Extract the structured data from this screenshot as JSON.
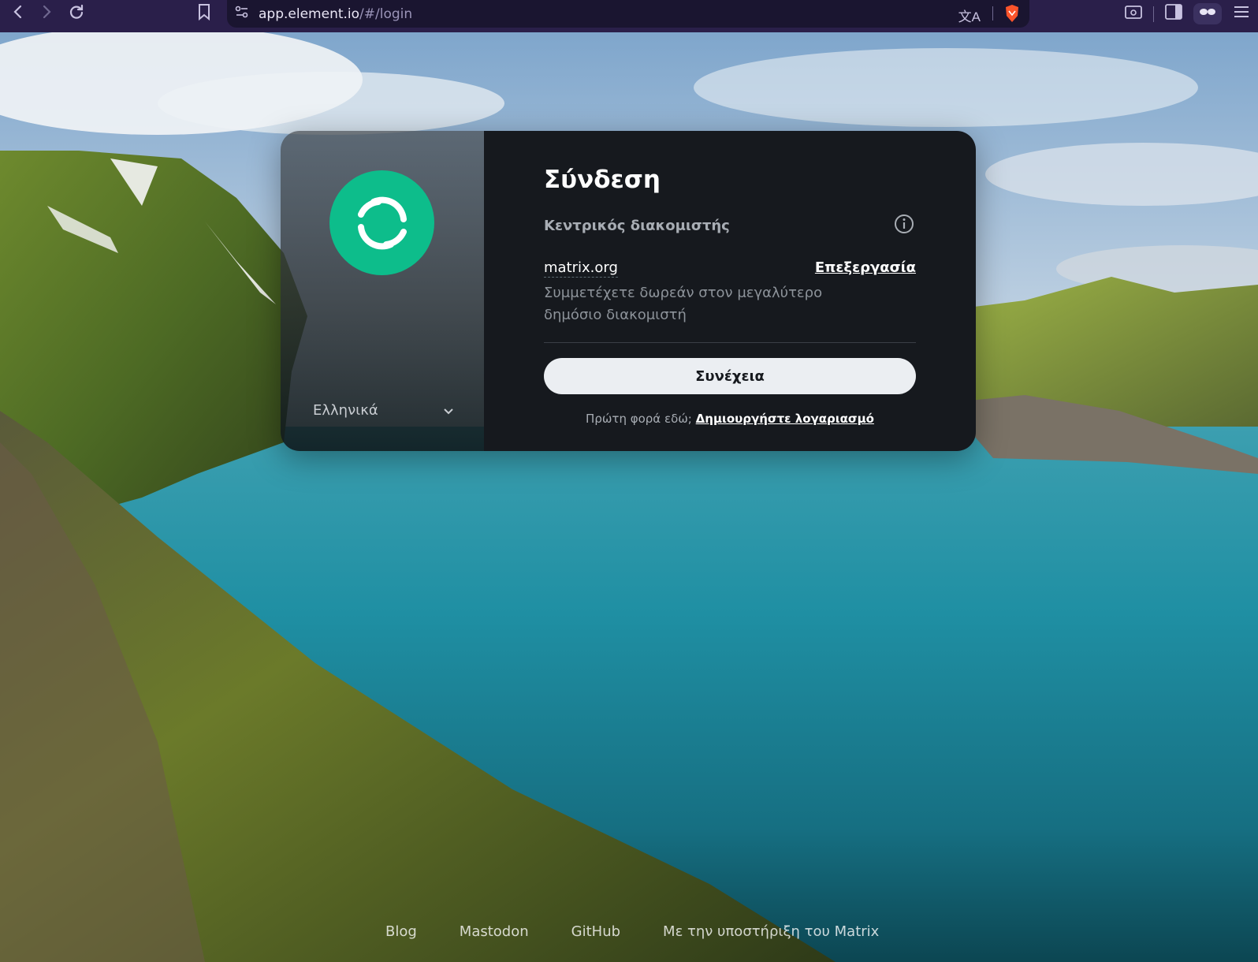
{
  "browser": {
    "url_host": "app.element.io",
    "url_path": "/#/login"
  },
  "card": {
    "language": "Ελληνικά",
    "title": "Σύνδεση",
    "homeserver_label": "Κεντρικός διακομιστής",
    "homeserver_name": "matrix.org",
    "edit_label": "Επεξεργασία",
    "homeserver_description": "Συμμετέχετε δωρεάν στον μεγαλύτερο δημόσιο διακομιστή",
    "continue_label": "Συνέχεια",
    "first_time_text": "Πρώτη φορά εδώ;",
    "create_account_label": "Δημιουργήστε λογαριασμό"
  },
  "footer": {
    "links": [
      "Blog",
      "Mastodon",
      "GitHub",
      "Με την υποστήριξη του Matrix"
    ]
  },
  "colors": {
    "brand": "#0dbd8b",
    "panel": "#16191e",
    "chrome": "#2a1f4a"
  }
}
